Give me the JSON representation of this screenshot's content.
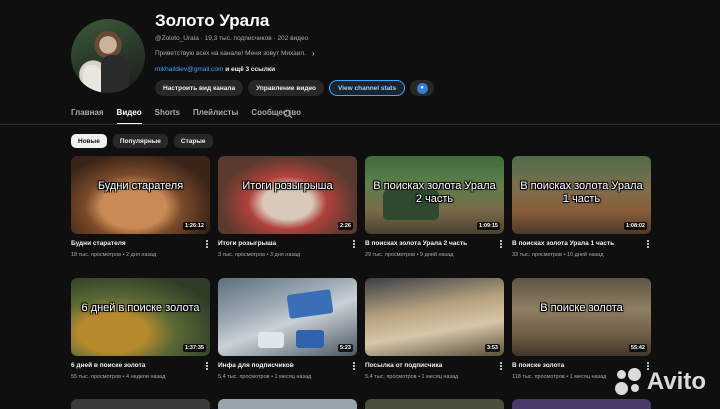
{
  "channel": {
    "name": "Золото Урала",
    "meta": "@Zoloto_Urala · 19,3 тыс. подписчиков · 202 видео",
    "description": "Приветствую всех на канале! Меня зовут Михаил.",
    "link": "mikhaildiev@gmail.com",
    "more_links": "и ещё 3 ссылки"
  },
  "actions": {
    "customize": "Настроить вид канала",
    "manage": "Управление видео",
    "stats": "View channel stats"
  },
  "tabs": [
    "Главная",
    "Видео",
    "Shorts",
    "Плейлисты",
    "Сообщество"
  ],
  "active_tab": "Видео",
  "chips": [
    "Новые",
    "Популярные",
    "Старые"
  ],
  "active_chip": "Новые",
  "videos": [
    {
      "title": "Будни старателя",
      "overlay": "Будни старателя",
      "duration": "1:26:12",
      "meta": "18 тыс. просмотров • 2 дня назад"
    },
    {
      "title": "Итоги розыгрыша",
      "overlay": "Итоги розыгрыша",
      "duration": "2:26",
      "meta": "3 тыс. просмотров • 3 дня назад"
    },
    {
      "title": "В поисках золота Урала 2 часть",
      "overlay": "В поисках золота Урала 2 часть",
      "duration": "1:09:15",
      "meta": "29 тыс. просмотров • 9 дней назад"
    },
    {
      "title": "В поисках золота Урала 1 часть",
      "overlay": "В поисках золота Урала 1 часть",
      "duration": "1:08:02",
      "meta": "33 тыс. просмотров • 10 дней назад"
    },
    {
      "title": "6 дней в поиске золота",
      "overlay": "6 дней в поиске золота",
      "duration": "1:37:35",
      "meta": "55 тыс. просмотров • 4 недели назад"
    },
    {
      "title": "Инфа для подписчиков",
      "overlay": "",
      "duration": "5:23",
      "meta": "5,4 тыс. просмотров • 1 месяц назад"
    },
    {
      "title": "Посылка от подписчика",
      "overlay": "",
      "duration": "3:53",
      "meta": "5,4 тыс. просмотров • 1 месяц назад"
    },
    {
      "title": "В поиске золота",
      "overlay": "В поиске золота",
      "duration": "55:42",
      "meta": "118 тыс. просмотров • 1 месяц назад"
    }
  ],
  "watermark": "Avito",
  "icons": {
    "search": "search-icon",
    "chevron": "chevron-right-icon",
    "kebab": "more-vert-icon",
    "stats": "analytics-icon"
  }
}
